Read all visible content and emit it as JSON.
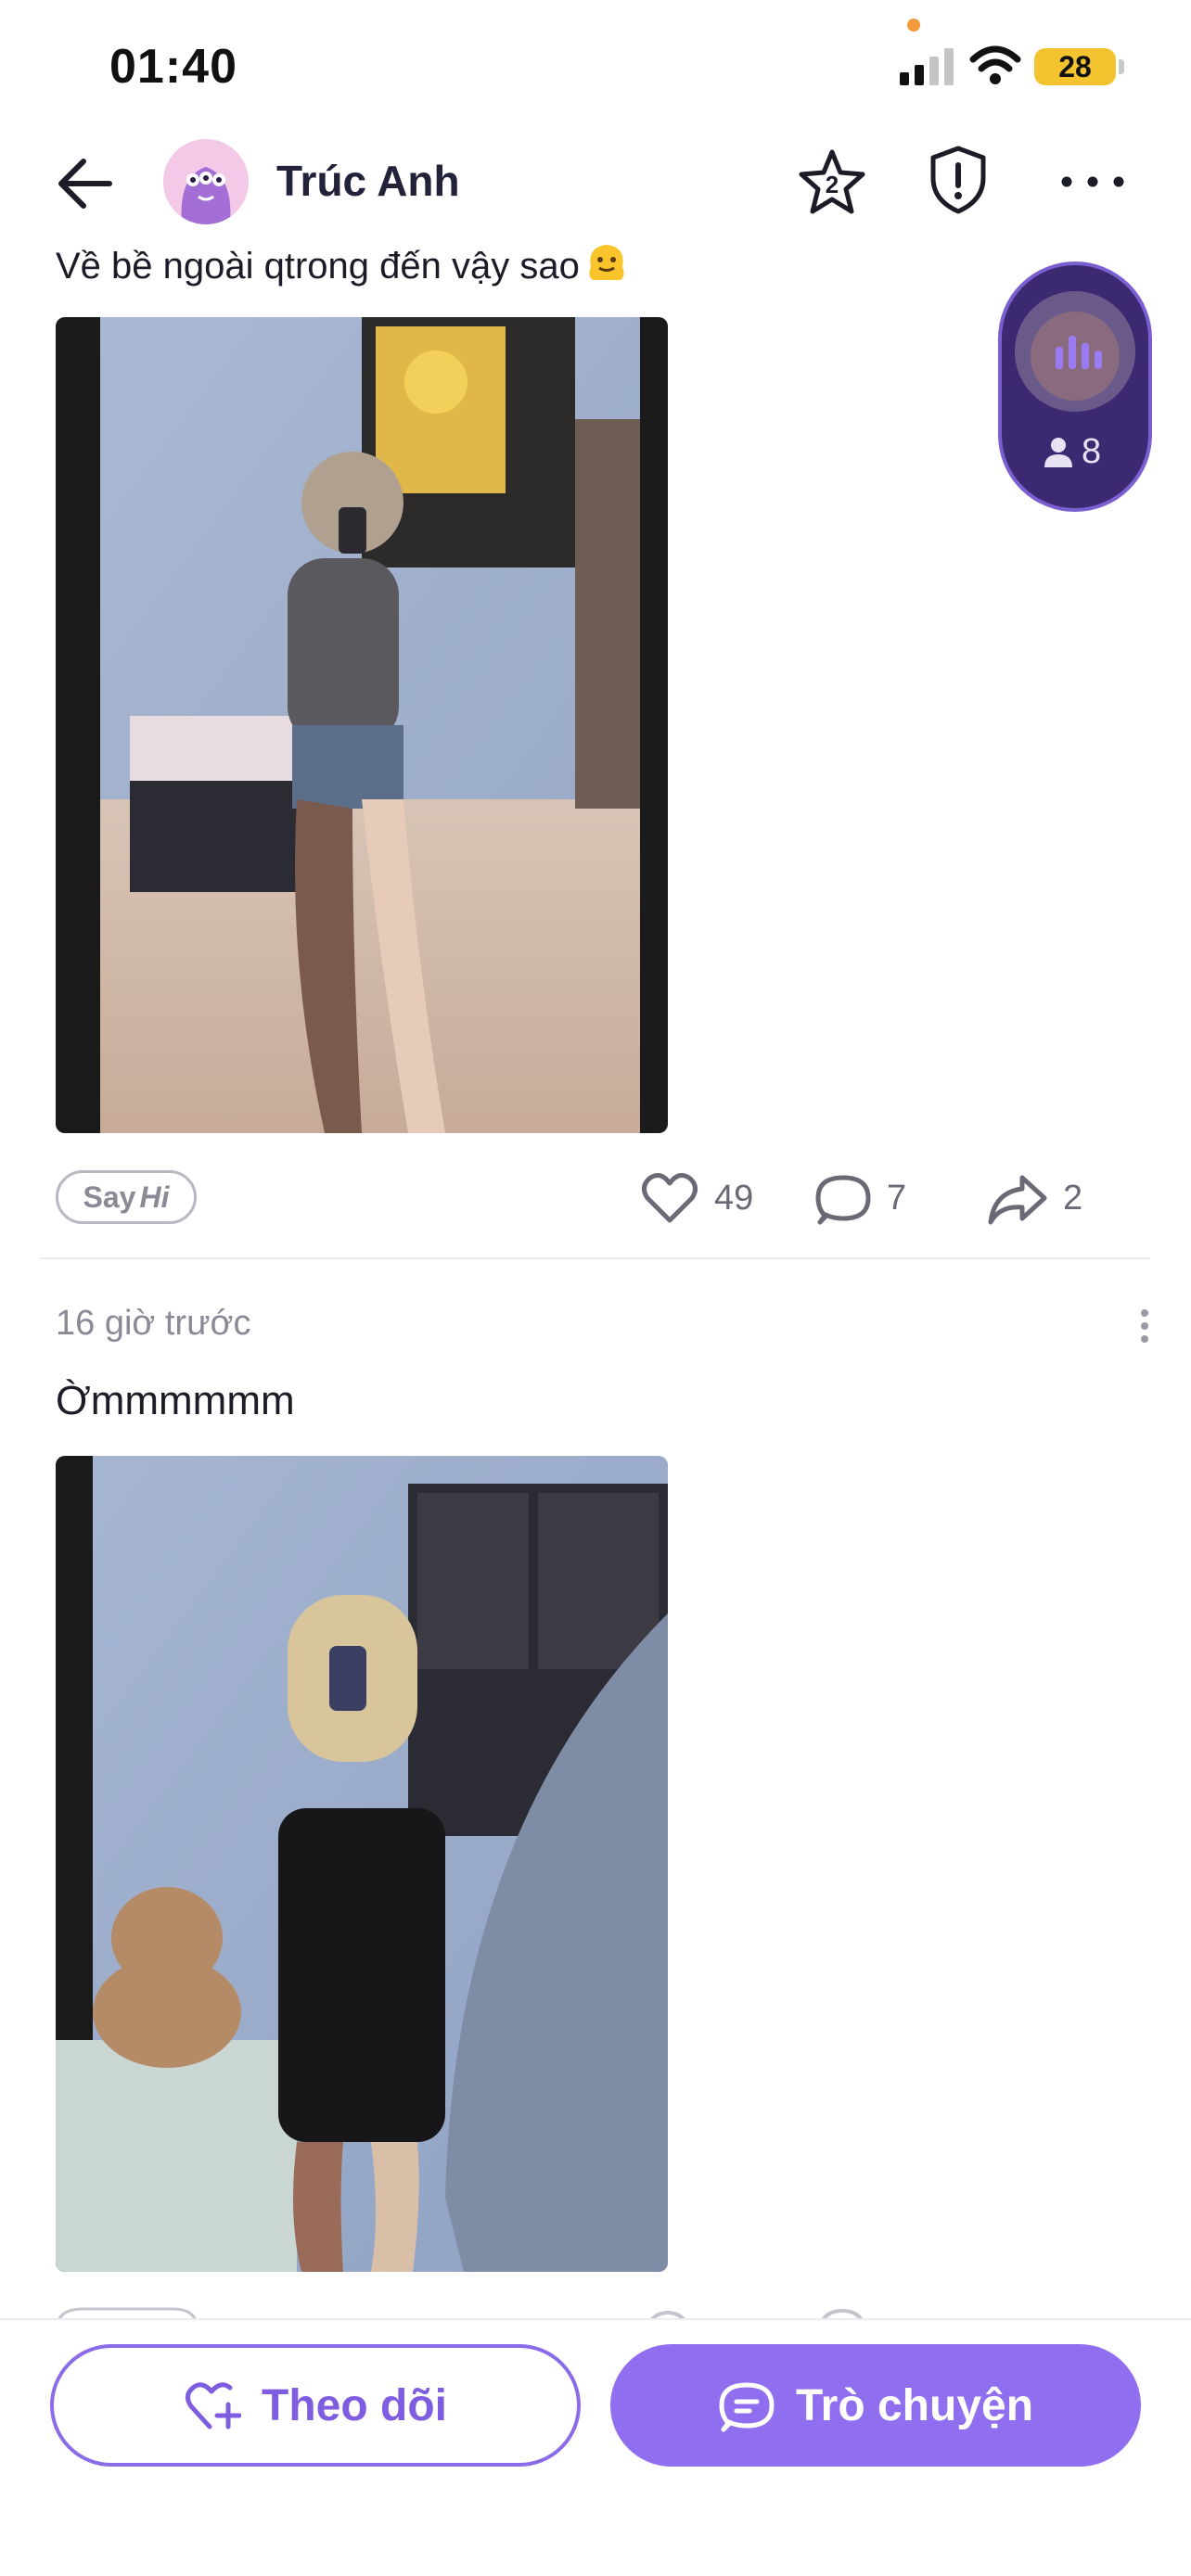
{
  "status_bar": {
    "time": "01:40",
    "battery": "28",
    "icons": [
      "signal-icon",
      "wifi-icon",
      "battery-icon"
    ]
  },
  "header": {
    "user_name": "Trúc Anh",
    "icons": [
      "back-arrow-icon",
      "star-icon",
      "shield-alert-icon",
      "more-icon"
    ],
    "star_badge": "2"
  },
  "room": {
    "listener_count": "8",
    "icon": "person-icon"
  },
  "posts": [
    {
      "caption": "Về bề ngoài qtrong đến vậy sao",
      "caption_emoji": "melting-face-emoji",
      "say_hi": {
        "say": "Say",
        "hi": "Hi"
      },
      "likes": "49",
      "comments": "7",
      "shares": "2"
    },
    {
      "time": "16 giờ trước",
      "caption": "Ờmmmmmm"
    }
  ],
  "actions": {
    "follow_label": "Theo dõi",
    "chat_label": "Trò chuyện"
  },
  "colors": {
    "accent": "#8f6ef0",
    "room_bg": "#3b2a72",
    "battery": "#f4c430",
    "text_muted": "#8a8a96"
  }
}
